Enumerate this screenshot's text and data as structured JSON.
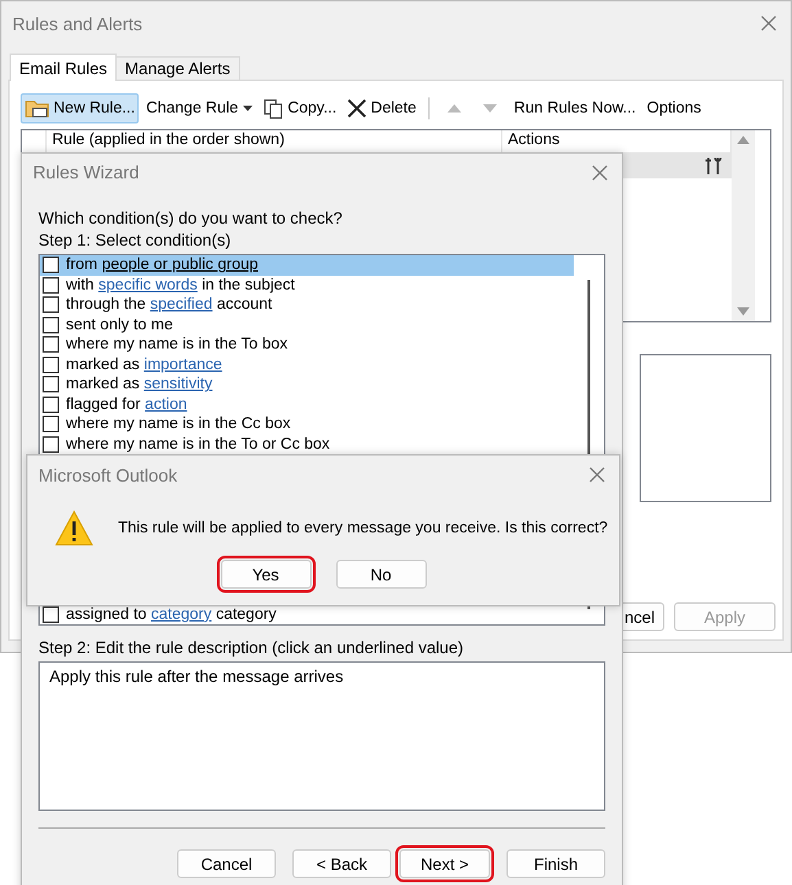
{
  "rules_and_alerts": {
    "title": "Rules and Alerts",
    "tabs": [
      {
        "label": "Email Rules",
        "selected": true
      },
      {
        "label": "Manage Alerts",
        "selected": false
      }
    ],
    "toolbar": [
      {
        "kind": "new",
        "label": "New Rule...",
        "focused": true,
        "disabled": false
      },
      {
        "kind": "dropdown",
        "label": "Change Rule",
        "focused": false,
        "disabled": false
      },
      {
        "kind": "copy",
        "label": "Copy...",
        "focused": false,
        "disabled": false
      },
      {
        "kind": "delete",
        "label": "Delete",
        "focused": false,
        "disabled": false
      },
      {
        "kind": "separator"
      },
      {
        "kind": "up",
        "disabled": true
      },
      {
        "kind": "down",
        "disabled": true
      },
      {
        "kind": "text",
        "label": "Run Rules Now...",
        "focused": false,
        "disabled": false
      },
      {
        "kind": "text",
        "label": "Options",
        "focused": false,
        "disabled": false
      }
    ],
    "columns": [
      "Rule (applied in the order shown)",
      "Actions"
    ],
    "rows": [
      {
        "selected": true
      }
    ],
    "buttons": [
      {
        "label": "ncel",
        "disabled": false
      },
      {
        "label": "Apply",
        "disabled": true
      }
    ]
  },
  "rules_wizard": {
    "title": "Rules Wizard",
    "question": "Which condition(s) do you want to check?",
    "step1": "Step 1: Select condition(s)",
    "conditions": [
      {
        "selected": true,
        "checked": false,
        "parts": [
          {
            "text": "from "
          },
          {
            "text": "people or public group",
            "link": true
          }
        ]
      },
      {
        "selected": false,
        "checked": false,
        "parts": [
          {
            "text": "with "
          },
          {
            "text": "specific words",
            "link": true
          },
          {
            "text": " in the subject"
          }
        ]
      },
      {
        "selected": false,
        "checked": false,
        "parts": [
          {
            "text": "through the "
          },
          {
            "text": "specified",
            "link": true
          },
          {
            "text": " account"
          }
        ]
      },
      {
        "selected": false,
        "checked": false,
        "parts": [
          {
            "text": "sent only to me"
          }
        ]
      },
      {
        "selected": false,
        "checked": false,
        "parts": [
          {
            "text": "where my name is in the To box"
          }
        ]
      },
      {
        "selected": false,
        "checked": false,
        "parts": [
          {
            "text": "marked as "
          },
          {
            "text": "importance",
            "link": true
          }
        ]
      },
      {
        "selected": false,
        "checked": false,
        "parts": [
          {
            "text": "marked as "
          },
          {
            "text": "sensitivity",
            "link": true
          }
        ]
      },
      {
        "selected": false,
        "checked": false,
        "parts": [
          {
            "text": "flagged for "
          },
          {
            "text": "action",
            "link": true
          }
        ]
      },
      {
        "selected": false,
        "checked": false,
        "parts": [
          {
            "text": "where my name is in the Cc box"
          }
        ]
      },
      {
        "selected": false,
        "checked": false,
        "parts": [
          {
            "text": "where my name is in the To or Cc box"
          }
        ]
      },
      {
        "selected": false,
        "checked": false,
        "parts": [
          {
            "text": "assigned to "
          },
          {
            "text": "category",
            "link": true
          },
          {
            "text": " category"
          }
        ]
      }
    ],
    "step2": "Step 2: Edit the rule description (click an underlined value)",
    "description": "Apply this rule after the message arrives",
    "buttons": [
      {
        "label": "Cancel",
        "marked": false
      },
      {
        "label": "< Back",
        "marked": false
      },
      {
        "label": "Next >",
        "marked": true
      },
      {
        "label": "Finish",
        "marked": false
      }
    ]
  },
  "alert": {
    "title": "Microsoft Outlook",
    "message": "This rule will be applied to every message you receive. Is this correct?",
    "buttons": [
      {
        "label": "Yes",
        "marked": true
      },
      {
        "label": "No",
        "marked": false
      }
    ]
  }
}
